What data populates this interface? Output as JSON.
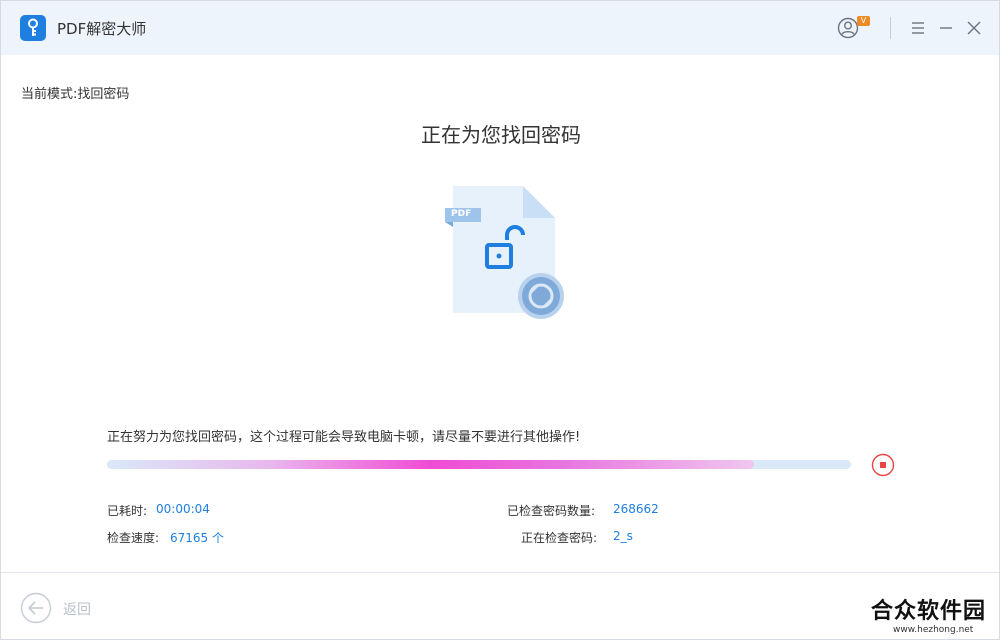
{
  "app": {
    "title": "PDF解密大师"
  },
  "header": {
    "vip_badge": "V"
  },
  "mode": {
    "label": "当前模式:",
    "value": "找回密码"
  },
  "heading": "正在为您找回密码",
  "illustration": {
    "badge": "PDF"
  },
  "progress": {
    "message": "正在努力为您找回密码，这个过程可能会导致电脑卡顿，请尽量不要进行其他操作!",
    "fraction": 0.87
  },
  "stats": {
    "elapsed_label": "已耗时:",
    "elapsed_value": "00:00:04",
    "speed_label": "检查速度:",
    "speed_value": "67165 个",
    "checked_label": "已检查密码数量:",
    "checked_value": "268662",
    "current_label": "正在检查密码:",
    "current_value": "2_s"
  },
  "footer": {
    "back_label": "返回"
  },
  "watermark": {
    "title": "合众软件园",
    "url": "www.hezhong.net"
  },
  "colors": {
    "accent": "#1e7fe0",
    "stop": "#e84545",
    "titlebar_bg": "#eef4fb"
  }
}
